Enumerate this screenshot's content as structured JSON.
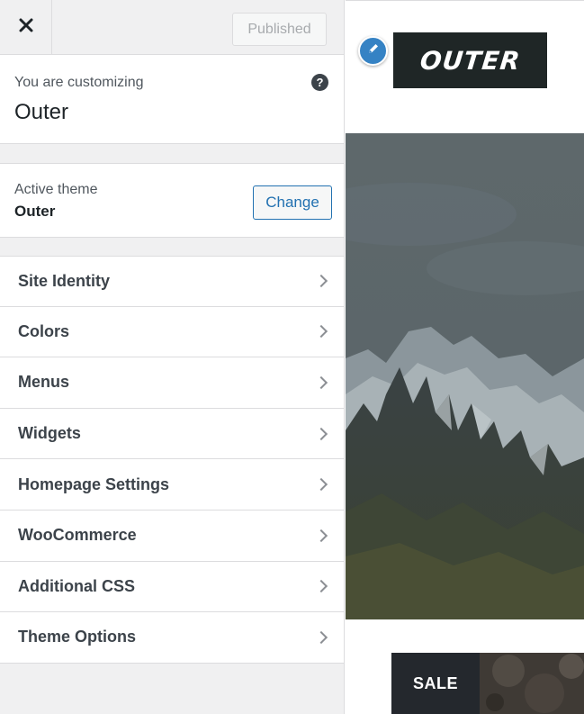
{
  "header": {
    "close_icon": "close-icon",
    "status_label": "Published"
  },
  "customizing": {
    "label": "You are customizing",
    "site_title": "Outer",
    "help_icon": "question-circle-icon",
    "help_glyph": "?"
  },
  "theme": {
    "label": "Active theme",
    "name": "Outer",
    "change_label": "Change"
  },
  "menu": {
    "items": [
      {
        "label": "Site Identity"
      },
      {
        "label": "Colors"
      },
      {
        "label": "Menus"
      },
      {
        "label": "Widgets"
      },
      {
        "label": "Homepage Settings"
      },
      {
        "label": "WooCommerce"
      },
      {
        "label": "Additional CSS"
      },
      {
        "label": "Theme Options"
      }
    ]
  },
  "preview": {
    "logo_text": "OUTER",
    "edit_icon": "pencil-icon",
    "sale_label": "SALE"
  },
  "colors": {
    "accent": "#2271b1",
    "edit_badge": "#3582c4",
    "logo_bg": "#1f2626"
  }
}
